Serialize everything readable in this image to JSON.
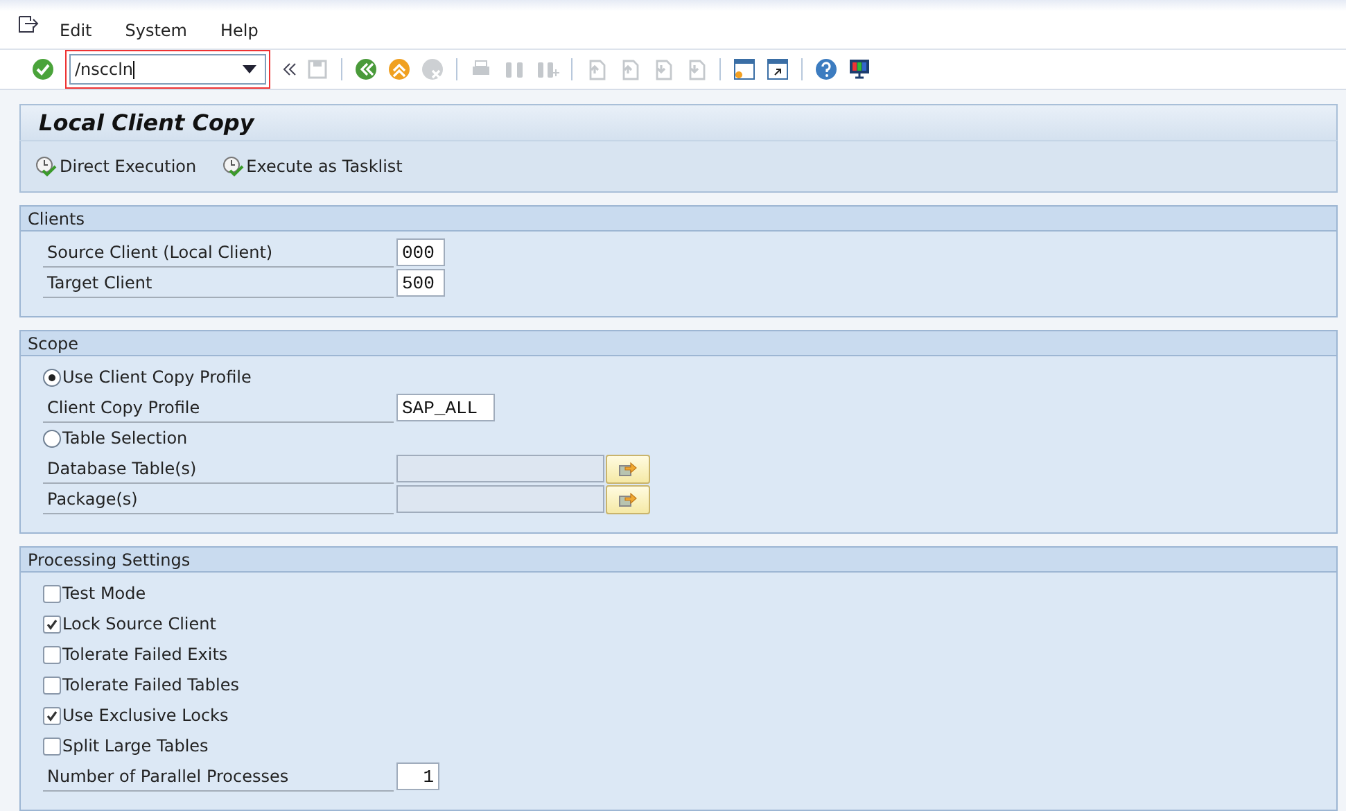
{
  "menu": [
    "Edit",
    "System",
    "Help"
  ],
  "command_field": {
    "value": "/nsccln"
  },
  "screen_title": "Local Client Copy",
  "app_toolbar": [
    "Direct Execution",
    "Execute as Tasklist"
  ],
  "sections": [
    {
      "title": "Clients",
      "rows": [
        {
          "kind": "field",
          "label": "Source Client (Local Client)",
          "value": "000",
          "disabled": false
        },
        {
          "kind": "field",
          "label": "Target Client",
          "value": "500",
          "disabled": false
        }
      ]
    },
    {
      "title": "Scope",
      "rows": [
        {
          "kind": "radio",
          "label": "Use Client Copy Profile",
          "selected": true
        },
        {
          "kind": "field",
          "label": "Client Copy Profile",
          "value": "SAP_ALL",
          "disabled": false
        },
        {
          "kind": "radio",
          "label": "Table Selection",
          "selected": false
        },
        {
          "kind": "picker",
          "label": "Database Table(s)",
          "disabled": true
        },
        {
          "kind": "picker",
          "label": "Package(s)",
          "disabled": true
        }
      ]
    },
    {
      "title": "Processing Settings",
      "rows": [
        {
          "kind": "checkbox",
          "label": "Test Mode",
          "checked": false
        },
        {
          "kind": "checkbox",
          "label": "Lock Source Client",
          "checked": true
        },
        {
          "kind": "checkbox",
          "label": "Tolerate Failed Exits",
          "checked": false
        },
        {
          "kind": "checkbox",
          "label": "Tolerate Failed Tables",
          "checked": false
        },
        {
          "kind": "checkbox",
          "label": "Use Exclusive Locks",
          "checked": true
        },
        {
          "kind": "checkbox",
          "label": "Split Large Tables",
          "checked": false
        },
        {
          "kind": "count",
          "label": "Number of Parallel Processes",
          "value": "1",
          "disabled": false
        }
      ]
    }
  ]
}
